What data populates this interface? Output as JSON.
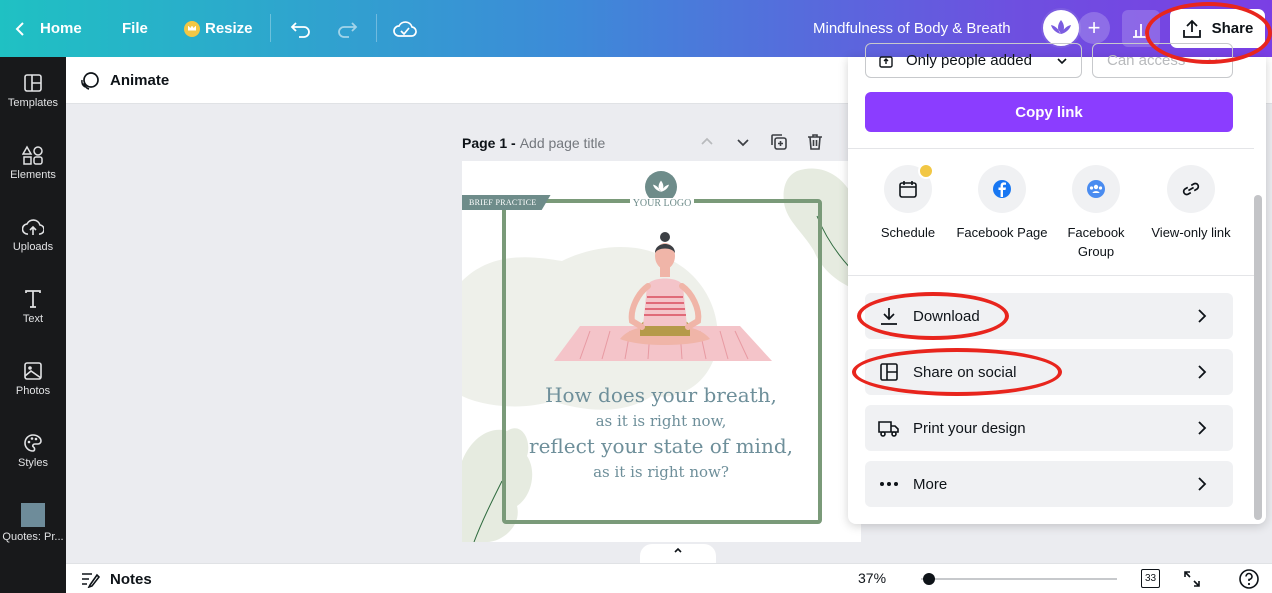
{
  "topbar": {
    "home_label": "Home",
    "file_label": "File",
    "resize_label": "Resize",
    "doc_title": "Mindfulness of Body & Breath",
    "share_label": "Share"
  },
  "subbar": {
    "animate_label": "Animate"
  },
  "sidebar": {
    "items": [
      {
        "label": "Templates",
        "icon": "templates-icon"
      },
      {
        "label": "Elements",
        "icon": "elements-icon"
      },
      {
        "label": "Uploads",
        "icon": "uploads-icon"
      },
      {
        "label": "Text",
        "icon": "text-icon"
      },
      {
        "label": "Photos",
        "icon": "photos-icon"
      },
      {
        "label": "Styles",
        "icon": "styles-icon"
      },
      {
        "label": "Quotes: Pr...",
        "icon": "project-thumbnail"
      }
    ]
  },
  "page": {
    "title": "Page 1 - ",
    "title_placeholder": "Add page title"
  },
  "design": {
    "badge": "BRIEF PRACTICE",
    "logo_text": "YOUR LOGO",
    "quote_lines": [
      "How does your breath,",
      "as it is right now,",
      "reflect your state of mind,",
      "as it is right now?"
    ]
  },
  "share_panel": {
    "access_select": "Only people added",
    "permission_select": "Can access",
    "copy_link": "Copy link",
    "shortcuts": [
      {
        "label": "Schedule",
        "icon": "schedule-icon",
        "premium": true
      },
      {
        "label": "Facebook Page",
        "icon": "facebook-icon"
      },
      {
        "label": "Facebook Group",
        "icon": "facebook-group-icon"
      },
      {
        "label": "View-only link",
        "icon": "link-icon"
      }
    ],
    "options": [
      {
        "label": "Download",
        "icon": "download-icon"
      },
      {
        "label": "Share on social",
        "icon": "share-social-icon"
      },
      {
        "label": "Print your design",
        "icon": "truck-icon"
      },
      {
        "label": "More",
        "icon": "more-icon"
      }
    ]
  },
  "bottombar": {
    "notes_label": "Notes",
    "zoom": "37%",
    "page_count": "33"
  },
  "colors": {
    "accent": "#8b3dff",
    "annotation": "#e8251d",
    "frame_green": "#7a9a79"
  }
}
